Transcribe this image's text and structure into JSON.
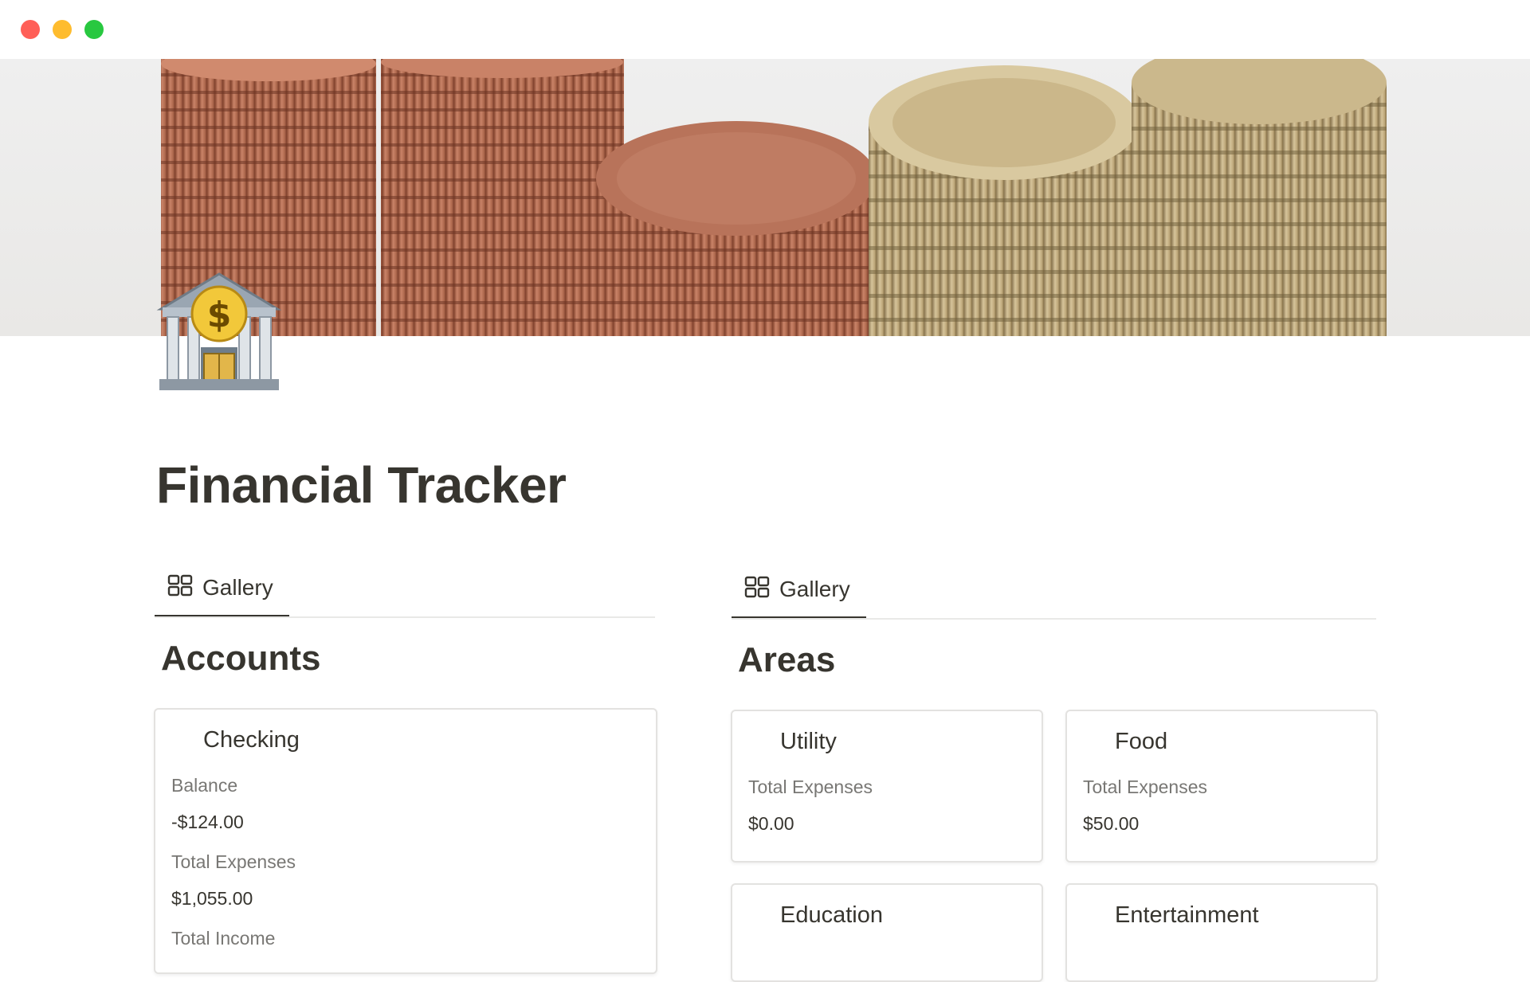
{
  "window": {
    "controls": [
      "close",
      "minimize",
      "zoom"
    ]
  },
  "cover": {
    "image": "stacked-coins-cover"
  },
  "page": {
    "icon": "bank-icon",
    "title": "Financial Tracker"
  },
  "views": [
    {
      "tab_label": "Gallery",
      "tab_icon": "gallery-icon",
      "title": "Accounts",
      "cards": [
        {
          "title": "Checking",
          "props": [
            {
              "label": "Balance",
              "value": "-$124.00"
            },
            {
              "label": "Total Expenses",
              "value": "$1,055.00"
            },
            {
              "label": "Total Income",
              "value": ""
            }
          ]
        }
      ]
    },
    {
      "tab_label": "Gallery",
      "tab_icon": "gallery-icon",
      "title": "Areas",
      "cards": [
        {
          "title": "Utility",
          "props": [
            {
              "label": "Total Expenses",
              "value": "$0.00"
            }
          ]
        },
        {
          "title": "Food",
          "props": [
            {
              "label": "Total Expenses",
              "value": "$50.00"
            }
          ]
        },
        {
          "title": "Education",
          "props": []
        },
        {
          "title": "Entertainment",
          "props": []
        }
      ]
    }
  ]
}
